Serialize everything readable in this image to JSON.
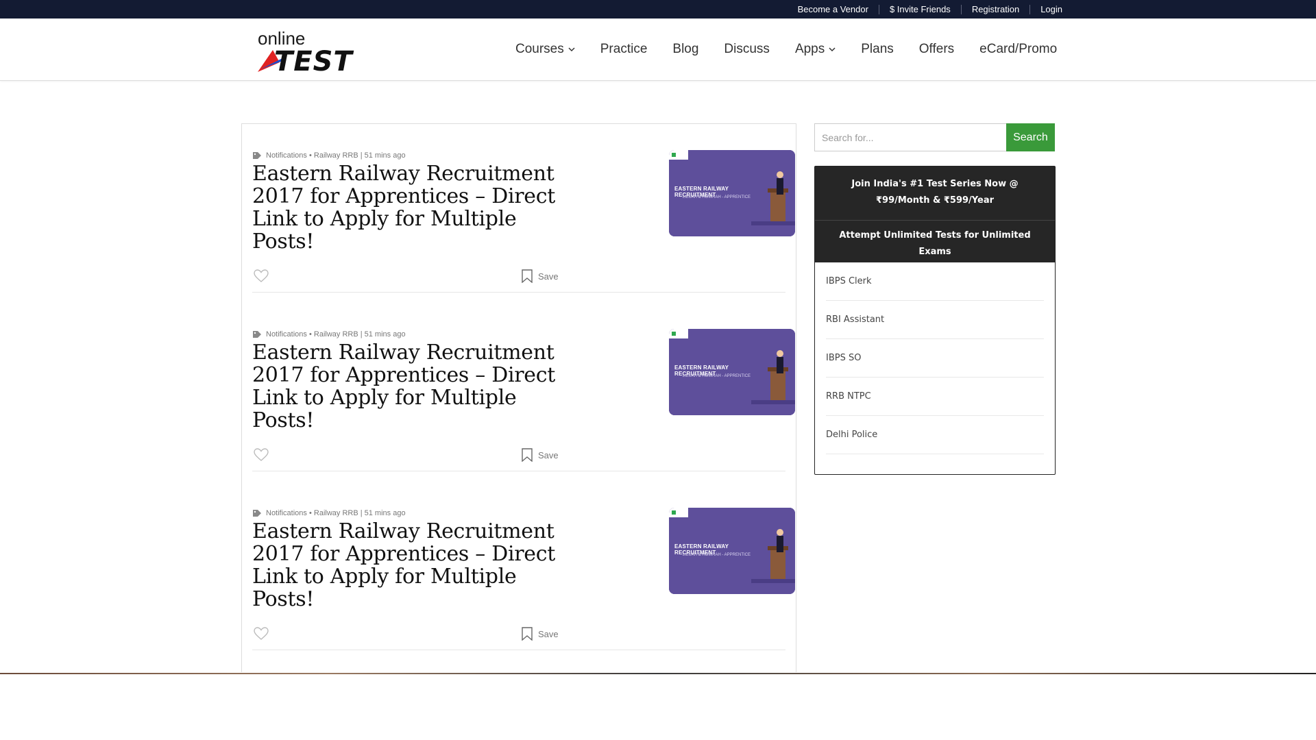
{
  "topbar": {
    "links": [
      "Become a Vendor",
      "$ Invite Friends",
      "Registration",
      "Login"
    ]
  },
  "header": {
    "logo_text_top": "online",
    "logo_text_main": "TEST",
    "nav": [
      {
        "label": "Courses",
        "dropdown": true
      },
      {
        "label": "Practice",
        "dropdown": false
      },
      {
        "label": "Blog",
        "dropdown": false
      },
      {
        "label": "Discuss",
        "dropdown": false
      },
      {
        "label": "Apps",
        "dropdown": true
      },
      {
        "label": "Plans",
        "dropdown": false
      },
      {
        "label": "Offers",
        "dropdown": false
      },
      {
        "label": "eCard/Promo",
        "dropdown": false
      }
    ]
  },
  "posts": [
    {
      "meta": "Notifications • Railway RRB  |  51 mins ago",
      "title": "Eastern Railway Recruitment 2017 for Apprentices – Direct Link to Apply for Multiple Posts!",
      "thumb_title": "EASTERN RAILWAY RECRUITMENT",
      "thumb_sub": "LILUAH & HOWRAH - APPRENTICE",
      "save_label": "Save"
    },
    {
      "meta": "Notifications • Railway RRB  |  51 mins ago",
      "title": "Eastern Railway Recruitment 2017 for Apprentices – Direct Link to Apply for Multiple Posts!",
      "thumb_title": "EASTERN RAILWAY RECRUITMENT",
      "thumb_sub": "LILUAH & HOWRAH - APPRENTICE",
      "save_label": "Save"
    },
    {
      "meta": "Notifications • Railway RRB  |  51 mins ago",
      "title": "Eastern Railway Recruitment 2017 for Apprentices – Direct Link to Apply for Multiple Posts!",
      "thumb_title": "EASTERN RAILWAY RECRUITMENT",
      "thumb_sub": "LILUAH & HOWRAH - APPRENTICE",
      "save_label": "Save"
    }
  ],
  "sidebar": {
    "search": {
      "placeholder": "Search for...",
      "button": "Search"
    },
    "promo": {
      "line1": "Join India's #1 Test Series Now @ ₹99/Month & ₹599/Year",
      "line2": "Attempt Unlimited Tests for Unlimited Exams"
    },
    "exams": [
      "IBPS Clerk",
      "RBI Assistant",
      "IBPS SO",
      "RRB NTPC",
      "Delhi Police"
    ]
  },
  "colors": {
    "topbar": "#131b33",
    "search_button": "#3a9a3a",
    "thumb_bg": "#5e4f9b",
    "promo_bg": "#262626"
  }
}
